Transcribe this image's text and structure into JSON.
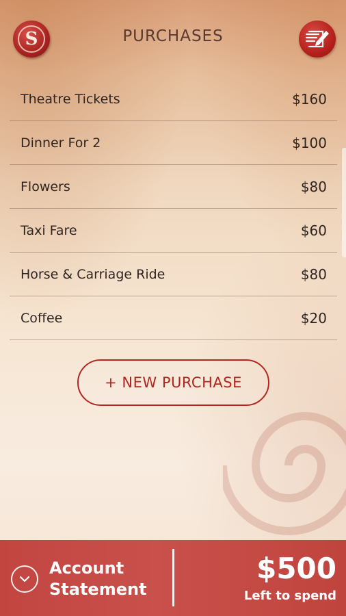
{
  "header": {
    "logo_letter": "S",
    "title": "PURCHASES"
  },
  "purchases": [
    {
      "name": "Theatre Tickets",
      "price": "$160"
    },
    {
      "name": "Dinner For 2",
      "price": "$100"
    },
    {
      "name": "Flowers",
      "price": "$80"
    },
    {
      "name": "Taxi Fare",
      "price": "$60"
    },
    {
      "name": "Horse & Carriage Ride",
      "price": "$80"
    },
    {
      "name": "Coffee",
      "price": "$20"
    }
  ],
  "new_purchase_label": "+ NEW PURCHASE",
  "footer": {
    "label_line1": "Account",
    "label_line2": "Statement",
    "amount": "$500",
    "amount_caption": "Left to spend"
  },
  "colors": {
    "accent": "#b3261f",
    "footer_bg": "#c24540",
    "text": "#2e2420"
  },
  "icons": {
    "logo": "s-logo-icon",
    "edit": "pencil-note-icon",
    "footer": "chevron-down-icon"
  }
}
